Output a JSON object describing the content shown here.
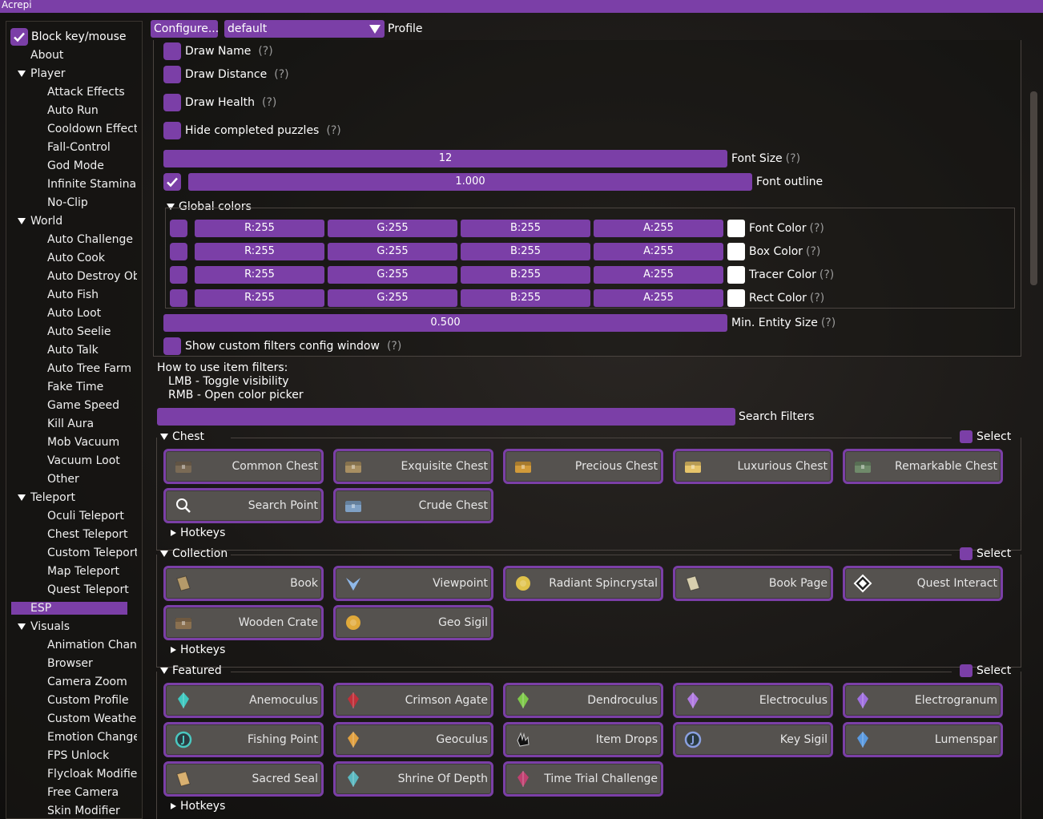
{
  "window": {
    "title": "Acrepi"
  },
  "sidebar": {
    "block_label": "Block key/mouse",
    "items": [
      {
        "label": "About",
        "level": 0
      },
      {
        "label": "Player",
        "level": 0,
        "group": true
      },
      {
        "label": "Attack Effects",
        "level": 1
      },
      {
        "label": "Auto Run",
        "level": 1
      },
      {
        "label": "Cooldown Effects",
        "level": 1
      },
      {
        "label": "Fall-Control",
        "level": 1
      },
      {
        "label": "God Mode",
        "level": 1
      },
      {
        "label": "Infinite Stamina",
        "level": 1
      },
      {
        "label": "No-Clip",
        "level": 1
      },
      {
        "label": "World",
        "level": 0,
        "group": true
      },
      {
        "label": "Auto Challenge",
        "level": 1
      },
      {
        "label": "Auto Cook",
        "level": 1
      },
      {
        "label": "Auto Destroy Objects",
        "level": 1
      },
      {
        "label": "Auto Fish",
        "level": 1
      },
      {
        "label": "Auto Loot",
        "level": 1
      },
      {
        "label": "Auto Seelie",
        "level": 1
      },
      {
        "label": "Auto Talk",
        "level": 1
      },
      {
        "label": "Auto Tree Farm",
        "level": 1
      },
      {
        "label": "Fake Time",
        "level": 1
      },
      {
        "label": "Game Speed",
        "level": 1
      },
      {
        "label": "Kill Aura",
        "level": 1
      },
      {
        "label": "Mob Vacuum",
        "level": 1
      },
      {
        "label": "Vacuum Loot",
        "level": 1
      },
      {
        "label": "Other",
        "level": 1
      },
      {
        "label": "Teleport",
        "level": 0,
        "group": true
      },
      {
        "label": "Oculi Teleport",
        "level": 1
      },
      {
        "label": "Chest Teleport",
        "level": 1
      },
      {
        "label": "Custom Teleports",
        "level": 1
      },
      {
        "label": "Map Teleport",
        "level": 1
      },
      {
        "label": "Quest Teleport",
        "level": 1
      },
      {
        "label": "ESP",
        "level": 0,
        "active": true
      },
      {
        "label": "Visuals",
        "level": 0,
        "group": true
      },
      {
        "label": "Animation Changer",
        "level": 1
      },
      {
        "label": "Browser",
        "level": 1
      },
      {
        "label": "Camera Zoom",
        "level": 1
      },
      {
        "label": "Custom Profile",
        "level": 1
      },
      {
        "label": "Custom Weather",
        "level": 1
      },
      {
        "label": "Emotion Changer",
        "level": 1
      },
      {
        "label": "FPS Unlock",
        "level": 1
      },
      {
        "label": "Flycloak Modifier",
        "level": 1
      },
      {
        "label": "Free Camera",
        "level": 1
      },
      {
        "label": "Skin Modifier",
        "level": 1
      }
    ]
  },
  "topbar": {
    "configure_label": "Configure...",
    "profile_value": "default",
    "profile_label": "Profile"
  },
  "esp": {
    "help_mark": "(?)",
    "draw_name": "Draw Name",
    "draw_distance": "Draw Distance",
    "draw_health": "Draw Health",
    "hide_puzzles": "Hide completed puzzles",
    "font_size_value": "12",
    "font_size_label": "Font Size",
    "font_outline_value": "1.000",
    "font_outline_label": "Font outline",
    "global_colors_label": "Global colors",
    "color_rows": [
      {
        "r": "R:255",
        "g": "G:255",
        "b": "B:255",
        "a": "A:255",
        "label": "Font Color",
        "color": "#ffffff"
      },
      {
        "r": "R:255",
        "g": "G:255",
        "b": "B:255",
        "a": "A:255",
        "label": "Box Color",
        "color": "#ffffff"
      },
      {
        "r": "R:255",
        "g": "G:255",
        "b": "B:255",
        "a": "A:255",
        "label": "Tracer Color",
        "color": "#ffffff"
      },
      {
        "r": "R:255",
        "g": "G:255",
        "b": "B:255",
        "a": "A:255",
        "label": "Rect Color",
        "color": "#ffffff"
      }
    ],
    "min_entity_value": "0.500",
    "min_entity_label": "Min. Entity Size",
    "custom_filters_label": "Show custom filters config window",
    "info_title": "How to use item filters:",
    "info_lmb": "LMB - Toggle visibility",
    "info_rmb": "RMB - Open color picker",
    "search_label": "Search Filters",
    "select_label": "Select",
    "hotkeys_label": "Hotkeys",
    "chest": {
      "title": "Chest",
      "items": [
        {
          "label": "Common Chest",
          "icon": "common-chest-icon",
          "color": "#7a6a55"
        },
        {
          "label": "Exquisite Chest",
          "icon": "exquisite-chest-icon",
          "color": "#a88f62"
        },
        {
          "label": "Precious Chest",
          "icon": "precious-chest-icon",
          "color": "#d19a3a"
        },
        {
          "label": "Luxurious Chest",
          "icon": "luxurious-chest-icon",
          "color": "#e6c46a"
        },
        {
          "label": "Remarkable Chest",
          "icon": "remarkable-chest-icon",
          "color": "#6f8a6a"
        },
        {
          "label": "Search Point",
          "icon": "search-point-icon",
          "color": "#ffffff"
        },
        {
          "label": "Crude Chest",
          "icon": "crude-chest-icon",
          "color": "#7fa0c4"
        }
      ]
    },
    "collection": {
      "title": "Collection",
      "items": [
        {
          "label": "Book",
          "icon": "book-icon",
          "color": "#b59a6a"
        },
        {
          "label": "Viewpoint",
          "icon": "viewpoint-icon",
          "color": "#8fb8e8"
        },
        {
          "label": "Radiant Spincrystal",
          "icon": "radiant-spincrystal-icon",
          "color": "#e0c24a"
        },
        {
          "label": "Book Page",
          "icon": "book-page-icon",
          "color": "#d8cfae"
        },
        {
          "label": "Quest Interact",
          "icon": "quest-interact-icon",
          "color": "#ffffff"
        },
        {
          "label": "Wooden Crate",
          "icon": "wooden-crate-icon",
          "color": "#8a7050"
        },
        {
          "label": "Geo Sigil",
          "icon": "geo-sigil-icon",
          "color": "#e0a93a"
        }
      ]
    },
    "featured": {
      "title": "Featured",
      "items": [
        {
          "label": "Anemoculus",
          "icon": "anemoculus-icon",
          "color": "#3fc8c0"
        },
        {
          "label": "Crimson Agate",
          "icon": "crimson-agate-icon",
          "color": "#c0303a"
        },
        {
          "label": "Dendroculus",
          "icon": "dendroculus-icon",
          "color": "#7ec84a"
        },
        {
          "label": "Electroculus",
          "icon": "electroculus-icon",
          "color": "#b07ae0"
        },
        {
          "label": "Electrogranum",
          "icon": "electrogranum-icon",
          "color": "#a070e0"
        },
        {
          "label": "Fishing Point",
          "icon": "fishing-point-icon",
          "color": "#4ac8c0"
        },
        {
          "label": "Geoculus",
          "icon": "geoculus-icon",
          "color": "#e0a040"
        },
        {
          "label": "Item Drops",
          "icon": "item-drops-icon",
          "color": "#1a1a1a"
        },
        {
          "label": "Key Sigil",
          "icon": "key-sigil-icon",
          "color": "#8aa0e0"
        },
        {
          "label": "Lumenspar",
          "icon": "lumenspar-icon",
          "color": "#5a9ae0"
        },
        {
          "label": "Sacred Seal",
          "icon": "sacred-seal-icon",
          "color": "#d8b070"
        },
        {
          "label": "Shrine Of Depth",
          "icon": "shrine-of-depth-icon",
          "color": "#5ab8c0"
        },
        {
          "label": "Time Trial Challenge",
          "icon": "time-trial-challenge-icon",
          "color": "#c04070"
        }
      ]
    }
  },
  "accent": "#7b3fa7"
}
